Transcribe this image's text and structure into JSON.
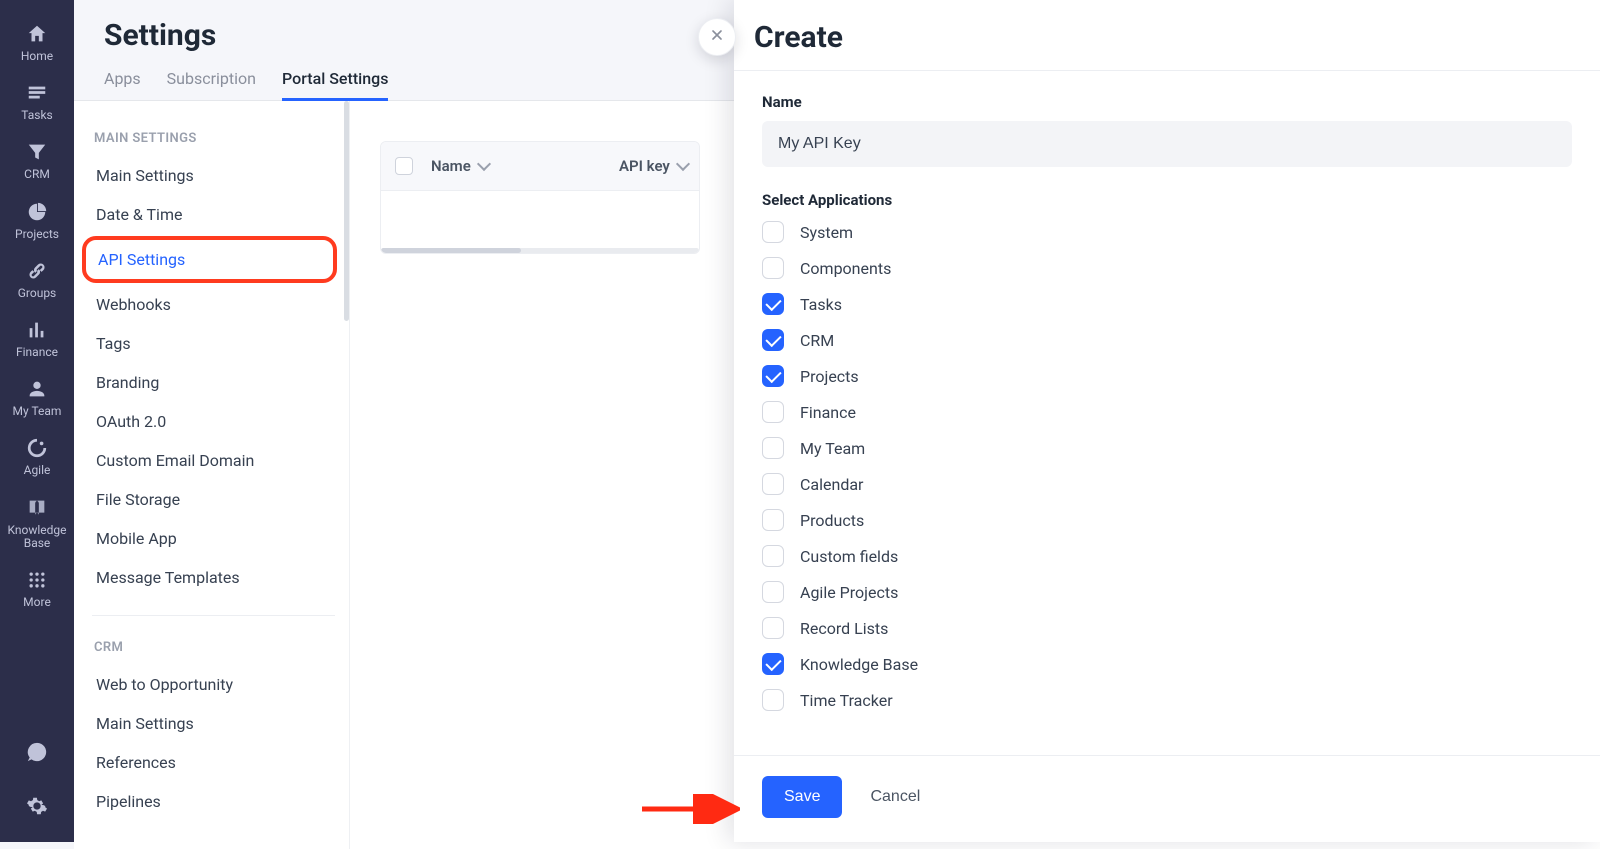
{
  "leftnav": {
    "items": [
      {
        "label": "Home",
        "icon": "home"
      },
      {
        "label": "Tasks",
        "icon": "tasks"
      },
      {
        "label": "CRM",
        "icon": "funnel"
      },
      {
        "label": "Projects",
        "icon": "dashboard"
      },
      {
        "label": "Groups",
        "icon": "link"
      },
      {
        "label": "Finance",
        "icon": "finance"
      },
      {
        "label": "My Team",
        "icon": "team"
      },
      {
        "label": "Agile",
        "icon": "agile"
      },
      {
        "label": "Knowledge Base",
        "icon": "book"
      },
      {
        "label": "More",
        "icon": "more"
      }
    ]
  },
  "page": {
    "title": "Settings",
    "tabs": [
      {
        "label": "Apps",
        "active": false
      },
      {
        "label": "Subscription",
        "active": false
      },
      {
        "label": "Portal Settings",
        "active": true
      }
    ]
  },
  "settings_sidebar": {
    "section1_title": "MAIN SETTINGS",
    "section1_items": [
      "Main Settings",
      "Date & Time",
      "API Settings",
      "Webhooks",
      "Tags",
      "Branding",
      "OAuth 2.0",
      "Custom Email Domain",
      "File Storage",
      "Mobile App",
      "Message Templates"
    ],
    "active_item": "API Settings",
    "highlighted_item": "API Settings",
    "section2_title": "CRM",
    "section2_items": [
      "Web to Opportunity",
      "Main Settings",
      "References",
      "Pipelines"
    ]
  },
  "table": {
    "columns": [
      "Name",
      "API key"
    ]
  },
  "panel": {
    "title": "Create",
    "name_label": "Name",
    "name_value": "My API Key",
    "apps_label": "Select Applications",
    "applications": [
      {
        "label": "System",
        "checked": false
      },
      {
        "label": "Components",
        "checked": false
      },
      {
        "label": "Tasks",
        "checked": true
      },
      {
        "label": "CRM",
        "checked": true
      },
      {
        "label": "Projects",
        "checked": true
      },
      {
        "label": "Finance",
        "checked": false
      },
      {
        "label": "My Team",
        "checked": false
      },
      {
        "label": "Calendar",
        "checked": false
      },
      {
        "label": "Products",
        "checked": false
      },
      {
        "label": "Custom fields",
        "checked": false
      },
      {
        "label": "Agile Projects",
        "checked": false
      },
      {
        "label": "Record Lists",
        "checked": false
      },
      {
        "label": "Knowledge Base",
        "checked": true
      },
      {
        "label": "Time Tracker",
        "checked": false
      }
    ],
    "save_label": "Save",
    "cancel_label": "Cancel"
  }
}
